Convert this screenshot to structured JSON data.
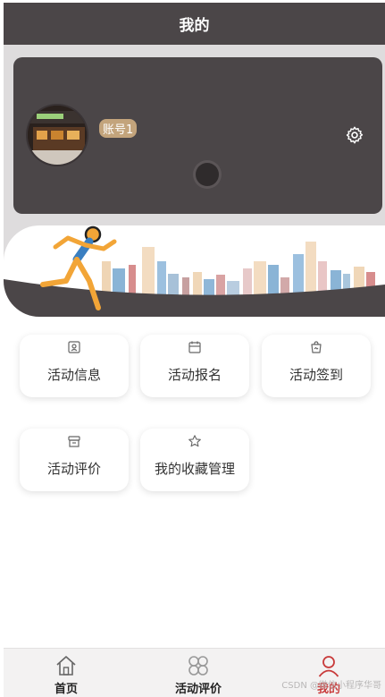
{
  "header": {
    "title": "我的"
  },
  "profile": {
    "username": "账号1"
  },
  "menu": [
    {
      "label": "活动信息",
      "icon": "profile-card-icon"
    },
    {
      "label": "活动报名",
      "icon": "calendar-icon"
    },
    {
      "label": "活动签到",
      "icon": "bag-icon"
    },
    {
      "label": "活动评价",
      "icon": "store-icon"
    },
    {
      "label": "我的收藏管理",
      "icon": "star-icon"
    }
  ],
  "tabbar": {
    "items": [
      {
        "label": "首页",
        "icon": "home-icon"
      },
      {
        "label": "活动评价",
        "icon": "clover-icon"
      },
      {
        "label": "我的",
        "icon": "person-icon",
        "active": true
      }
    ]
  },
  "watermark": "CSDN @微信小程序华哥",
  "colors": {
    "header_bg": "#4b4648",
    "active_tab": "#c83a3a",
    "badge_bg": "#c3a47c"
  }
}
